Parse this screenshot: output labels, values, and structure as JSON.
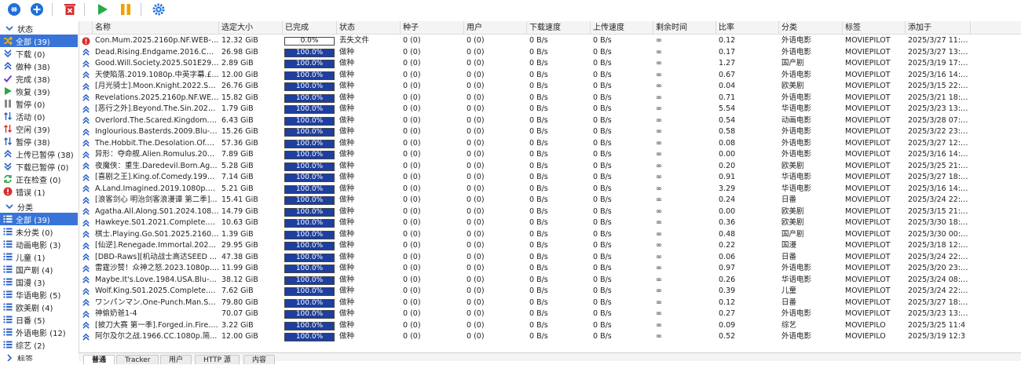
{
  "toolbar": {
    "buttons": [
      {
        "name": "link-icon",
        "color": "#1e6fd9"
      },
      {
        "name": "add-icon",
        "color": "#1e6fd9"
      },
      {
        "name": "delete-icon",
        "color": "#d62f2f"
      },
      {
        "name": "play-icon",
        "color": "#2aa84a"
      },
      {
        "name": "pause-icon",
        "color": "#f0a000"
      },
      {
        "name": "gear-icon",
        "color": "#1e6fd9"
      }
    ]
  },
  "sidebar": {
    "status_header": "状态",
    "status_items": [
      {
        "label": "全部 (39)",
        "icon": "shuffle-icon",
        "color": "#e6a300",
        "selected": true
      },
      {
        "label": "下载 (0)",
        "icon": "download-icon",
        "color": "#2d62c8"
      },
      {
        "label": "做种 (38)",
        "icon": "seed-icon",
        "color": "#2d62c8"
      },
      {
        "label": "完成 (38)",
        "icon": "check-icon",
        "color": "#6a3ec9"
      },
      {
        "label": "恢复 (39)",
        "icon": "resume-icon",
        "color": "#2aa84a"
      },
      {
        "label": "暂停 (0)",
        "icon": "pause-icon",
        "color": "#888888"
      },
      {
        "label": "活动 (0)",
        "icon": "active-icon",
        "color": "#2d62c8"
      },
      {
        "label": "空闲 (39)",
        "icon": "idle-icon",
        "color": "#d62f2f"
      },
      {
        "label": "暂停 (38)",
        "icon": "stalled-icon",
        "color": "#2d62c8"
      },
      {
        "label": "上传已暂停 (38)",
        "icon": "upload-paused-icon",
        "color": "#2d62c8"
      },
      {
        "label": "下载已暂停 (0)",
        "icon": "download-paused-icon",
        "color": "#2d62c8"
      },
      {
        "label": "正在检查 (0)",
        "icon": "checking-icon",
        "color": "#2aa84a"
      },
      {
        "label": "错误 (1)",
        "icon": "error-icon",
        "color": "#d62f2f"
      }
    ],
    "category_header": "分类",
    "category_items": [
      {
        "label": "全部 (39)",
        "selected": true
      },
      {
        "label": "未分类 (0)"
      },
      {
        "label": "动画电影 (3)"
      },
      {
        "label": "儿童 (1)"
      },
      {
        "label": "国产剧 (4)"
      },
      {
        "label": "国漫 (3)"
      },
      {
        "label": "华语电影 (5)"
      },
      {
        "label": "欧美剧 (4)"
      },
      {
        "label": "日番 (5)"
      },
      {
        "label": "外语电影 (12)"
      },
      {
        "label": "综艺 (2)"
      }
    ],
    "tags_header": "标签"
  },
  "table": {
    "columns": [
      "",
      "名称",
      "选定大小",
      "已完成",
      "状态",
      "种子",
      "用户",
      "下载速度",
      "上传速度",
      "剩余时间",
      "比率",
      "分类",
      "标签",
      "添加于"
    ],
    "rows": [
      {
        "icon": "error",
        "name": "Con.Mum.2025.2160p.NF.WEB-D...",
        "size": "12.32 GiB",
        "progress": "0.0%",
        "pct": 0,
        "state": "丢失文件",
        "seeds": "0 (0)",
        "peers": "0 (0)",
        "dl": "0 B/s",
        "ul": "0 B/s",
        "eta": "∞",
        "ratio": "0.12",
        "category": "外语电影",
        "tags": "MOVIEPILOT",
        "added": "2025/3/27 11:5..."
      },
      {
        "icon": "seed",
        "name": "Dead.Rising.Endgame.2016.COM...",
        "size": "26.98 GiB",
        "progress": "100.0%",
        "pct": 100,
        "state": "做种",
        "seeds": "0 (0)",
        "peers": "0 (0)",
        "dl": "0 B/s",
        "ul": "0 B/s",
        "eta": "∞",
        "ratio": "0.17",
        "category": "外语电影",
        "tags": "MOVIEPILOT",
        "added": "2025/3/27 13:3..."
      },
      {
        "icon": "seed",
        "name": "Good.Will.Society.2025.S01E29.2...",
        "size": "2.89 GiB",
        "progress": "100.0%",
        "pct": 100,
        "state": "做种",
        "seeds": "0 (0)",
        "peers": "0 (0)",
        "dl": "0 B/s",
        "ul": "0 B/s",
        "eta": "∞",
        "ratio": "1.27",
        "category": "国产剧",
        "tags": "MOVIEPILOT",
        "added": "2025/3/19 17:5..."
      },
      {
        "icon": "seed",
        "name": "天使陷落.2019.1080p.中英字幕.£...",
        "size": "12.00 GiB",
        "progress": "100.0%",
        "pct": 100,
        "state": "做种",
        "seeds": "0 (0)",
        "peers": "0 (0)",
        "dl": "0 B/s",
        "ul": "0 B/s",
        "eta": "∞",
        "ratio": "0.67",
        "category": "外语电影",
        "tags": "MOVIEPILOT",
        "added": "2025/3/16 14:0..."
      },
      {
        "icon": "seed",
        "name": "[月光骑士].Moon.Knight.2022.S01...",
        "size": "26.76 GiB",
        "progress": "100.0%",
        "pct": 100,
        "state": "做种",
        "seeds": "0 (0)",
        "peers": "0 (0)",
        "dl": "0 B/s",
        "ul": "0 B/s",
        "eta": "∞",
        "ratio": "0.04",
        "category": "欧美剧",
        "tags": "MOVIEPILOT",
        "added": "2025/3/15 22:0..."
      },
      {
        "icon": "seed",
        "name": "Revelations.2025.2160p.NF.WEB-...",
        "size": "15.82 GiB",
        "progress": "100.0%",
        "pct": 100,
        "state": "做种",
        "seeds": "0 (0)",
        "peers": "0 (0)",
        "dl": "0 B/s",
        "ul": "0 B/s",
        "eta": "∞",
        "ratio": "0.71",
        "category": "外语电影",
        "tags": "MOVIEPILOT",
        "added": "2025/3/21 18:5..."
      },
      {
        "icon": "seed",
        "name": "[恶行之外].Beyond.The.Sin.2025.2...",
        "size": "1.79 GiB",
        "progress": "100.0%",
        "pct": 100,
        "state": "做种",
        "seeds": "0 (0)",
        "peers": "0 (0)",
        "dl": "0 B/s",
        "ul": "0 B/s",
        "eta": "∞",
        "ratio": "5.54",
        "category": "华语电影",
        "tags": "MOVIEPILOT",
        "added": "2025/3/23 13:3..."
      },
      {
        "icon": "seed",
        "name": "Overlord.The.Scared.Kingdom.20...",
        "size": "6.43 GiB",
        "progress": "100.0%",
        "pct": 100,
        "state": "做种",
        "seeds": "0 (0)",
        "peers": "0 (0)",
        "dl": "0 B/s",
        "ul": "0 B/s",
        "eta": "∞",
        "ratio": "0.54",
        "category": "动画电影",
        "tags": "MOVIEPILOT",
        "added": "2025/3/28 07:5..."
      },
      {
        "icon": "seed",
        "name": "Inglourious.Basterds.2009.Blu-ray...",
        "size": "15.26 GiB",
        "progress": "100.0%",
        "pct": 100,
        "state": "做种",
        "seeds": "0 (0)",
        "peers": "0 (0)",
        "dl": "0 B/s",
        "ul": "0 B/s",
        "eta": "∞",
        "ratio": "0.58",
        "category": "外语电影",
        "tags": "MOVIEPILOT",
        "added": "2025/3/22 23:5..."
      },
      {
        "icon": "seed",
        "name": "The.Hobbit.The.Desolation.Of.Sm...",
        "size": "57.36 GiB",
        "progress": "100.0%",
        "pct": 100,
        "state": "做种",
        "seeds": "0 (0)",
        "peers": "0 (0)",
        "dl": "0 B/s",
        "ul": "0 B/s",
        "eta": "∞",
        "ratio": "0.08",
        "category": "外语电影",
        "tags": "MOVIEPILOT",
        "added": "2025/3/27 12:0..."
      },
      {
        "icon": "seed",
        "name": "异形：夺命舰.Alien.Romulus.2024...",
        "size": "7.89 GiB",
        "progress": "100.0%",
        "pct": 100,
        "state": "做种",
        "seeds": "0 (0)",
        "peers": "0 (0)",
        "dl": "0 B/s",
        "ul": "0 B/s",
        "eta": "∞",
        "ratio": "0.00",
        "category": "外语电影",
        "tags": "MOVIEPILOT",
        "added": "2025/3/16 14:0..."
      },
      {
        "icon": "seed",
        "name": "夜魔侠：重生.Daredevil.Born.Agai...",
        "size": "5.28 GiB",
        "progress": "100.0%",
        "pct": 100,
        "state": "做种",
        "seeds": "0 (0)",
        "peers": "0 (0)",
        "dl": "0 B/s",
        "ul": "0 B/s",
        "eta": "∞",
        "ratio": "0.20",
        "category": "欧美剧",
        "tags": "MOVIEPILOT",
        "added": "2025/3/25 21:5..."
      },
      {
        "icon": "seed",
        "name": "[喜剧之王].King.of.Comedy.1999.2...",
        "size": "7.14 GiB",
        "progress": "100.0%",
        "pct": 100,
        "state": "做种",
        "seeds": "0 (0)",
        "peers": "0 (0)",
        "dl": "0 B/s",
        "ul": "0 B/s",
        "eta": "∞",
        "ratio": "0.91",
        "category": "华语电影",
        "tags": "MOVIEPILOT",
        "added": "2025/3/27 18:5..."
      },
      {
        "icon": "seed",
        "name": "A.Land.Imagined.2019.1080p.NF....",
        "size": "5.21 GiB",
        "progress": "100.0%",
        "pct": 100,
        "state": "做种",
        "seeds": "0 (0)",
        "peers": "0 (0)",
        "dl": "0 B/s",
        "ul": "0 B/s",
        "eta": "∞",
        "ratio": "3.29",
        "category": "华语电影",
        "tags": "MOVIEPILOT",
        "added": "2025/3/16 14:4..."
      },
      {
        "icon": "seed",
        "name": "[浪客剑心 明治剑客浪漫谭 第二季]...",
        "size": "15.41 GiB",
        "progress": "100.0%",
        "pct": 100,
        "state": "做种",
        "seeds": "0 (0)",
        "peers": "0 (0)",
        "dl": "0 B/s",
        "ul": "0 B/s",
        "eta": "∞",
        "ratio": "0.24",
        "category": "日番",
        "tags": "MOVIEPILOT",
        "added": "2025/3/24 22:0..."
      },
      {
        "icon": "seed",
        "name": "Agatha.All.Along.S01.2024.1080p...",
        "size": "14.79 GiB",
        "progress": "100.0%",
        "pct": 100,
        "state": "做种",
        "seeds": "0 (0)",
        "peers": "0 (0)",
        "dl": "0 B/s",
        "ul": "0 B/s",
        "eta": "∞",
        "ratio": "0.00",
        "category": "欧美剧",
        "tags": "MOVIEPILOT",
        "added": "2025/3/15 21:5..."
      },
      {
        "icon": "seed",
        "name": "Hawkeye.S01.2021.Complete.108...",
        "size": "10.63 GiB",
        "progress": "100.0%",
        "pct": 100,
        "state": "做种",
        "seeds": "0 (0)",
        "peers": "0 (0)",
        "dl": "0 B/s",
        "ul": "0 B/s",
        "eta": "∞",
        "ratio": "0.36",
        "category": "欧美剧",
        "tags": "MOVIEPILOT",
        "added": "2025/3/30 18:5..."
      },
      {
        "icon": "seed",
        "name": "棋士.Playing.Go.S01.2025.2160p....",
        "size": "1.39 GiB",
        "progress": "100.0%",
        "pct": 100,
        "state": "做种",
        "seeds": "0 (0)",
        "peers": "0 (0)",
        "dl": "0 B/s",
        "ul": "0 B/s",
        "eta": "∞",
        "ratio": "0.48",
        "category": "国产剧",
        "tags": "MOVIEPILOT",
        "added": "2025/3/30 00:0..."
      },
      {
        "icon": "seed",
        "name": "[仙逆].Renegade.Immortal.2023.S...",
        "size": "29.95 GiB",
        "progress": "100.0%",
        "pct": 100,
        "state": "做种",
        "seeds": "0 (0)",
        "peers": "0 (0)",
        "dl": "0 B/s",
        "ul": "0 B/s",
        "eta": "∞",
        "ratio": "0.22",
        "category": "国漫",
        "tags": "MOVIEPILOT",
        "added": "2025/3/18 12:4..."
      },
      {
        "icon": "seed",
        "name": "[DBD-Raws][机动战士高达SEED ...",
        "size": "47.38 GiB",
        "progress": "100.0%",
        "pct": 100,
        "state": "做种",
        "seeds": "0 (0)",
        "peers": "0 (0)",
        "dl": "0 B/s",
        "ul": "0 B/s",
        "eta": "∞",
        "ratio": "0.06",
        "category": "日番",
        "tags": "MOVIEPILOT",
        "added": "2025/3/24 22:0..."
      },
      {
        "icon": "seed",
        "name": "雷霆沙赞！众神之怒.2023.1080p....",
        "size": "11.99 GiB",
        "progress": "100.0%",
        "pct": 100,
        "state": "做种",
        "seeds": "0 (0)",
        "peers": "0 (0)",
        "dl": "0 B/s",
        "ul": "0 B/s",
        "eta": "∞",
        "ratio": "0.97",
        "category": "外语电影",
        "tags": "MOVIEPILOT",
        "added": "2025/3/20 23:0..."
      },
      {
        "icon": "seed",
        "name": "Maybe.It's.Love.1984.USA.Blu-ray...",
        "size": "38.12 GiB",
        "progress": "100.0%",
        "pct": 100,
        "state": "做种",
        "seeds": "0 (0)",
        "peers": "0 (0)",
        "dl": "0 B/s",
        "ul": "0 B/s",
        "eta": "∞",
        "ratio": "0.26",
        "category": "华语电影",
        "tags": "MOVIEPILOT",
        "added": "2025/3/24 08:0..."
      },
      {
        "icon": "seed",
        "name": "Wolf.King.S01.2025.Complete.108...",
        "size": "7.62 GiB",
        "progress": "100.0%",
        "pct": 100,
        "state": "做种",
        "seeds": "0 (0)",
        "peers": "0 (0)",
        "dl": "0 B/s",
        "ul": "0 B/s",
        "eta": "∞",
        "ratio": "0.39",
        "category": "儿童",
        "tags": "MOVIEPILOT",
        "added": "2025/3/24 22:0..."
      },
      {
        "icon": "seed",
        "name": "ワンパンマン.One-Punch.Man.S0...",
        "size": "79.80 GiB",
        "progress": "100.0%",
        "pct": 100,
        "state": "做种",
        "seeds": "0 (0)",
        "peers": "0 (0)",
        "dl": "0 B/s",
        "ul": "0 B/s",
        "eta": "∞",
        "ratio": "0.12",
        "category": "日番",
        "tags": "MOVIEPILOT",
        "added": "2025/3/27 18:2..."
      },
      {
        "icon": "seed",
        "name": "神偷奶爸1-4",
        "size": "70.07 GiB",
        "progress": "100.0%",
        "pct": 100,
        "state": "做种",
        "seeds": "0 (0)",
        "peers": "0 (0)",
        "dl": "0 B/s",
        "ul": "0 B/s",
        "eta": "∞",
        "ratio": "0.27",
        "category": "外语电影",
        "tags": "MOVIEPILOT",
        "added": "2025/3/23 13:2..."
      },
      {
        "icon": "seed",
        "name": "[披刀大赛 第一季].Forged.in.Fire.2...",
        "size": "3.22 GiB",
        "progress": "100.0%",
        "pct": 100,
        "state": "做种",
        "seeds": "0 (0)",
        "peers": "0 (0)",
        "dl": "0 B/s",
        "ul": "0 B/s",
        "eta": "∞",
        "ratio": "0.09",
        "category": "综艺",
        "tags": "MOVIEPILO",
        "added": "2025/3/25 11:4"
      },
      {
        "icon": "seed",
        "name": "阿尔及尔之战.1966.CC.1080p.简...",
        "size": "12.00 GiB",
        "progress": "100.0%",
        "pct": 100,
        "state": "做种",
        "seeds": "0 (0)",
        "peers": "0 (0)",
        "dl": "0 B/s",
        "ul": "0 B/s",
        "eta": "∞",
        "ratio": "0.52",
        "category": "外语电影",
        "tags": "MOVIEPILO",
        "added": "2025/3/19 12:3"
      }
    ]
  },
  "bottom_tabs": [
    "普通",
    "Tracker",
    "用户",
    "HTTP 源",
    "内容"
  ]
}
